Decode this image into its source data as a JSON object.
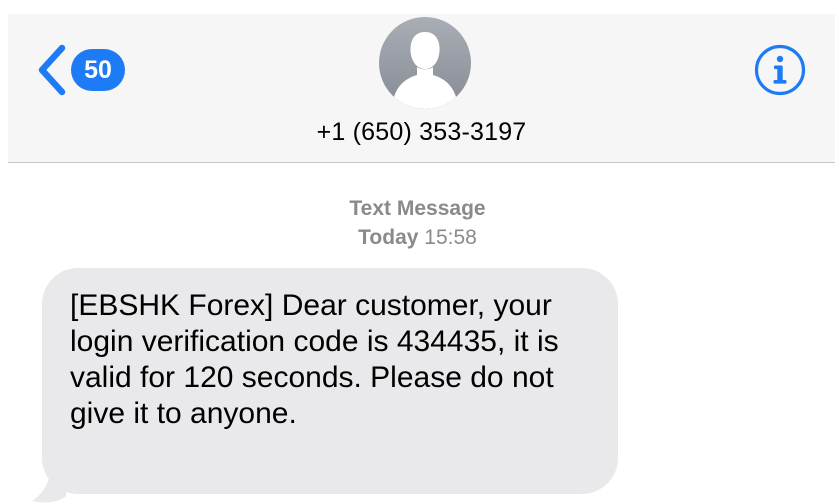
{
  "nav": {
    "back_badge": "50",
    "contact_name": "+1 (650) 353-3197",
    "info_icon": "info-icon",
    "avatar_icon": "person-silhouette-icon",
    "back_icon": "chevron-left-icon"
  },
  "thread": {
    "timestamp": {
      "kind": "Text Message",
      "day": "Today",
      "time": "15:58"
    },
    "messages": [
      {
        "direction": "incoming",
        "text": "[EBSHK Forex] Dear customer, your login verification code is 434435, it is valid for 120 seconds. Please do not give it to anyone."
      }
    ]
  },
  "colors": {
    "accent": "#1d7bf6",
    "incoming_bubble": "#e9e9eb",
    "header_bg": "#f6f6f6",
    "timestamp_gray": "#8a8a8e"
  }
}
